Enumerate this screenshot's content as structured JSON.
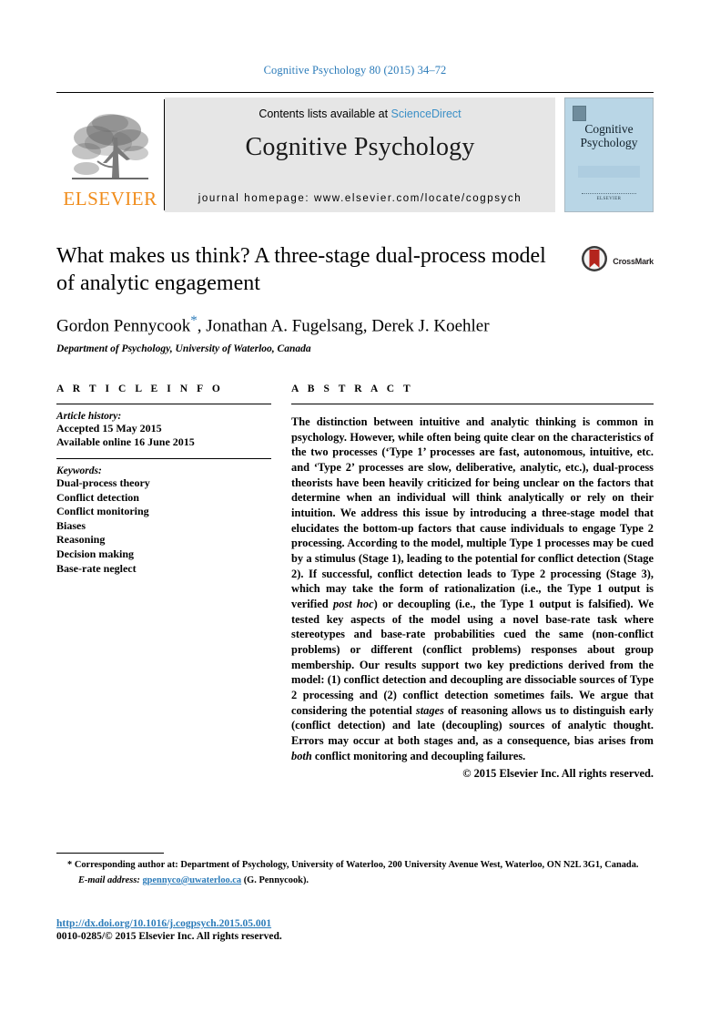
{
  "running_head": "Cognitive Psychology 80 (2015) 34–72",
  "masthead": {
    "publisher_name": "ELSEVIER",
    "contents_prefix": "Contents lists available at",
    "contents_link": "ScienceDirect",
    "journal_name": "Cognitive Psychology",
    "homepage": "journal homepage: www.elsevier.com/locate/cogpsych",
    "cover": {
      "title_line1": "Cognitive",
      "title_line2": "Psychology",
      "footer_word": "ELSEVIER"
    }
  },
  "article": {
    "title": "What makes us think? A three-stage dual-process model of analytic engagement",
    "crossmark_label": "CrossMark",
    "authors": "Gordon Pennycook",
    "corresponding_marker": "*",
    "authors_rest": ", Jonathan A. Fugelsang, Derek J. Koehler",
    "affiliation": "Department of Psychology, University of Waterloo, Canada"
  },
  "info": {
    "heading": "A R T I C L E   I N F O",
    "history_label": "Article history:",
    "history": [
      "Accepted 15 May 2015",
      "Available online 16 June 2015"
    ],
    "keywords_label": "Keywords:",
    "keywords": [
      "Dual-process theory",
      "Conflict detection",
      "Conflict monitoring",
      "Biases",
      "Reasoning",
      "Decision making",
      "Base-rate neglect"
    ]
  },
  "abstract": {
    "heading": "A B S T R A C T",
    "p1": "The distinction between intuitive and analytic thinking is common in psychology. However, while often being quite clear on the characteristics of the two processes (‘Type 1’ processes are fast, autonomous, intuitive, etc. and ‘Type 2’ processes are slow, deliberative, analytic, etc.), dual-process theorists have been heavily criticized for being unclear on the factors that determine when an individual will think analytically or rely on their intuition. We address this issue by introducing a three-stage model that elucidates the bottom-up factors that cause individuals to engage Type 2 processing. According to the model, multiple Type 1 processes may be cued by a stimulus (Stage 1), leading to the potential for conflict detection (Stage 2). If successful, conflict detection leads to Type 2 processing (Stage 3), which may take the form of rationalization (i.e., the Type 1 output is verified ",
    "italic1": "post hoc",
    "p2": ") or decoupling (i.e., the Type 1 output is falsified). We tested key aspects of the model using a novel base-rate task where stereotypes and base-rate probabilities cued the same (non-conflict problems) or different (conflict problems) responses about group membership. Our results support two key predictions derived from the model: (1) conflict detection and decoupling are dissociable sources of Type 2 processing and (2) conflict detection sometimes fails. We argue that considering the potential ",
    "italic2": "stages",
    "p3": " of reasoning allows us to distinguish early (conflict detection) and late (decoupling) sources of analytic thought. Errors may occur at both stages and, as a consequence, bias arises from ",
    "italic3": "both",
    "p4": " conflict monitoring and decoupling failures.",
    "copyright": "© 2015 Elsevier Inc. All rights reserved."
  },
  "footnotes": {
    "corresponding_star": "*",
    "corresponding_text": "Corresponding author at: Department of Psychology, University of Waterloo, 200 University Avenue West, Waterloo, ON N2L 3G1, Canada.",
    "email_label": "E-mail address:",
    "email_address": "gpennyco@uwaterloo.ca",
    "email_owner": "(G. Pennycook)."
  },
  "footer": {
    "doi": "http://dx.doi.org/10.1016/j.cogpsych.2015.05.001",
    "issn": "0010-0285/© 2015 Elsevier Inc. All rights reserved."
  },
  "colors": {
    "link_blue": "#2b7bb9",
    "elsevier_orange": "#f08c1b",
    "masthead_grey": "#e6e6e6",
    "cover_blue": "#b9d6e6"
  }
}
